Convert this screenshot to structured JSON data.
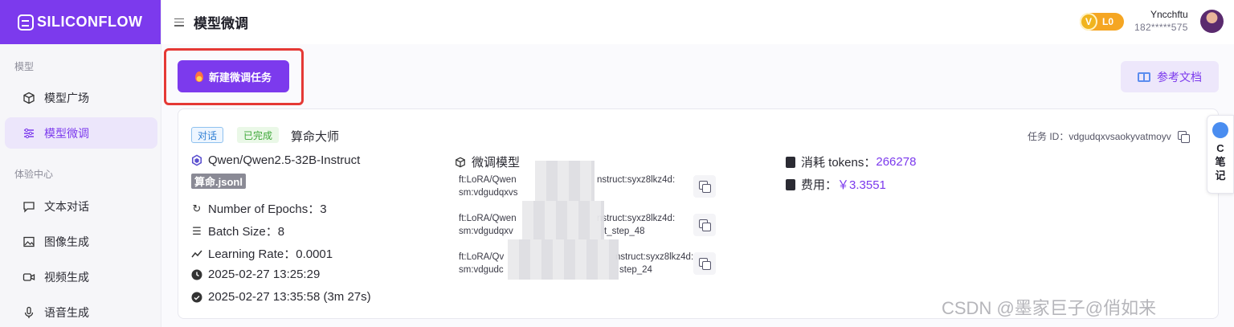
{
  "app": {
    "logo_text": "SILICONFLOW"
  },
  "sidebar": {
    "section_model": "模型",
    "section_experience": "体验中心",
    "items": [
      {
        "label": "模型广场",
        "icon": "cube-icon"
      },
      {
        "label": "模型微调",
        "icon": "sliders-icon",
        "active": true
      },
      {
        "label": "文本对话",
        "icon": "chat-icon"
      },
      {
        "label": "图像生成",
        "icon": "image-icon"
      },
      {
        "label": "视频生成",
        "icon": "video-icon"
      },
      {
        "label": "语音生成",
        "icon": "mic-icon"
      }
    ]
  },
  "header": {
    "title": "模型微调",
    "level": "L0",
    "level_icon_letter": "V",
    "user_name": "Yncchftu",
    "user_phone": "182*****575"
  },
  "main": {
    "new_task_label": "新建微调任务",
    "docs_label": "参考文档"
  },
  "task": {
    "tag_type": "对话",
    "tag_status": "已完成",
    "name": "算命大师",
    "id_label": "任务 ID：",
    "id_value": "vdgudqxvsaokyvatmoyv",
    "model": "Qwen/Qwen2.5-32B-Instruct",
    "dataset": "算命.jsonl",
    "epochs": "Number of Epochs：3",
    "batch_size": "Batch Size：8",
    "learning_rate": "Learning Rate：0.0001",
    "created_at": "2025-02-27 13:25:29",
    "finished_at": "2025-02-27 13:35:58 (3m 27s)",
    "finetuned_title": "微调模型",
    "finetuned": [
      {
        "line1": "ft:LoRA/Qwen",
        "line1_tail": "nstruct:syxz8lkz4d:",
        "line2": "sm:vdgudqxvs",
        "line2_tail": ""
      },
      {
        "line1": "ft:LoRA/Qwen",
        "line1_tail": "nstruct:syxz8lkz4d:",
        "line2": "sm:vdgudqxv",
        "line2_tail": "t_step_48"
      },
      {
        "line1": "ft:LoRA/Qv",
        "line1_tail": "nstruct:syxz8lkz4d:",
        "line2": "sm:vdgudc",
        "line2_tail": "step_24"
      }
    ],
    "tokens_label": "消耗 tokens：",
    "tokens_value": "266278",
    "fee_label": "费用：",
    "fee_value": "￥3.3551"
  },
  "side_note": {
    "letter": "C",
    "text1": "笔",
    "text2": "记"
  },
  "watermark": "CSDN @墨家巨子@俏如来",
  "colors": {
    "brand": "#7c3aed",
    "highlight_frame": "#e53935",
    "badge": "#f5a623"
  }
}
